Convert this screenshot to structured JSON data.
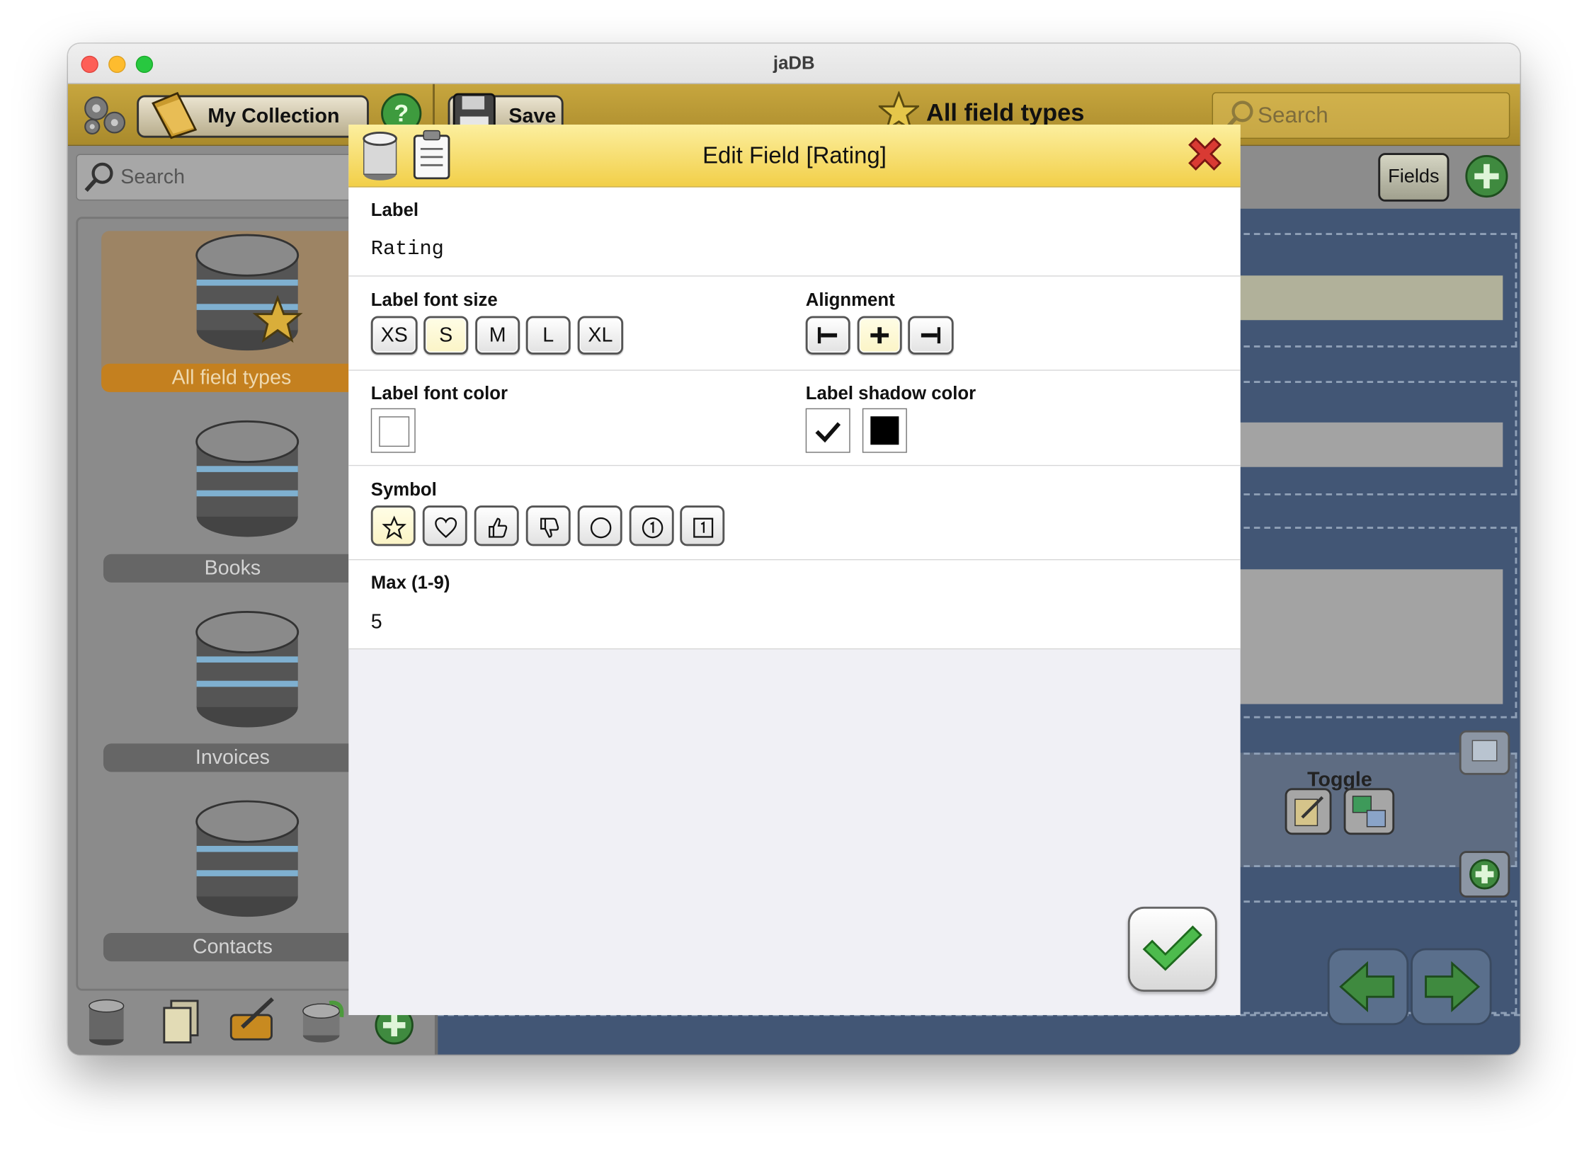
{
  "window": {
    "title": "jaDB"
  },
  "toolbar": {
    "collection_label": "My Collection",
    "save_label": "Save",
    "current_title": "All field types",
    "search_placeholder": "Search"
  },
  "sidebar": {
    "search_placeholder": "Search",
    "collections": [
      {
        "label": "All field types",
        "selected": true
      },
      {
        "label": "Books"
      },
      {
        "label": "Invoices"
      },
      {
        "label": "Contacts"
      }
    ]
  },
  "right": {
    "fields_label": "Fields",
    "toggle_label": "Toggle"
  },
  "dialog": {
    "title": "Edit Field [Rating]",
    "label_section": {
      "label": "Label",
      "value": "Rating"
    },
    "font_size": {
      "label": "Label font size",
      "options": [
        "XS",
        "S",
        "M",
        "L",
        "XL"
      ],
      "selected": "S"
    },
    "alignment": {
      "label": "Alignment",
      "options": [
        "left-align-icon",
        "center-align-icon",
        "right-align-icon"
      ],
      "selected": "center-align-icon"
    },
    "font_color": {
      "label": "Label font color",
      "color": "#ffffff"
    },
    "shadow_color": {
      "label": "Label shadow color",
      "enabled": true,
      "color": "#000000"
    },
    "symbol": {
      "label": "Symbol",
      "options": [
        "star-icon",
        "heart-icon",
        "thumbs-up-icon",
        "thumbs-down-icon",
        "circle-icon",
        "circled-one-icon",
        "boxed-one-icon"
      ],
      "selected": "star-icon"
    },
    "max": {
      "label": "Max (1-9)",
      "value": "5"
    }
  },
  "colors": {
    "toolbar": "#b8993a",
    "dialog_header": "#f5d75c",
    "selected_option": "#fbf4c6",
    "right_pane": "#425675"
  }
}
